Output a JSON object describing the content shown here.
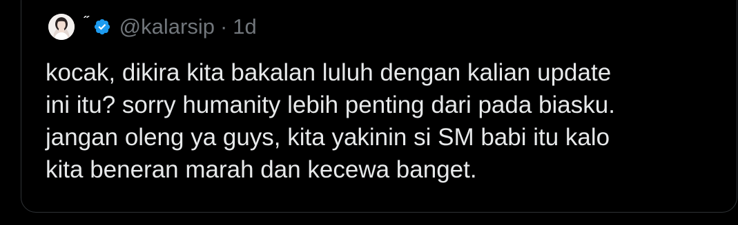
{
  "tweet": {
    "display_name": "˝",
    "handle": "@kalarsip",
    "separator": "·",
    "time": "1d",
    "text": "kocak, dikira kita bakalan luluh dengan kalian update\nini itu? sorry humanity lebih penting dari pada biasku.\njangan oleng ya guys, kita yakinin si SM babi itu kalo\nkita beneran marah dan kecewa banget."
  },
  "icons": {
    "avatar": "avatar-photo",
    "verified": "verified-badge-icon"
  },
  "colors": {
    "background": "#000000",
    "text_primary": "#e7e9ea",
    "text_secondary": "#71767b",
    "border": "#2f3336",
    "verified_blue": "#1d9bf0"
  }
}
